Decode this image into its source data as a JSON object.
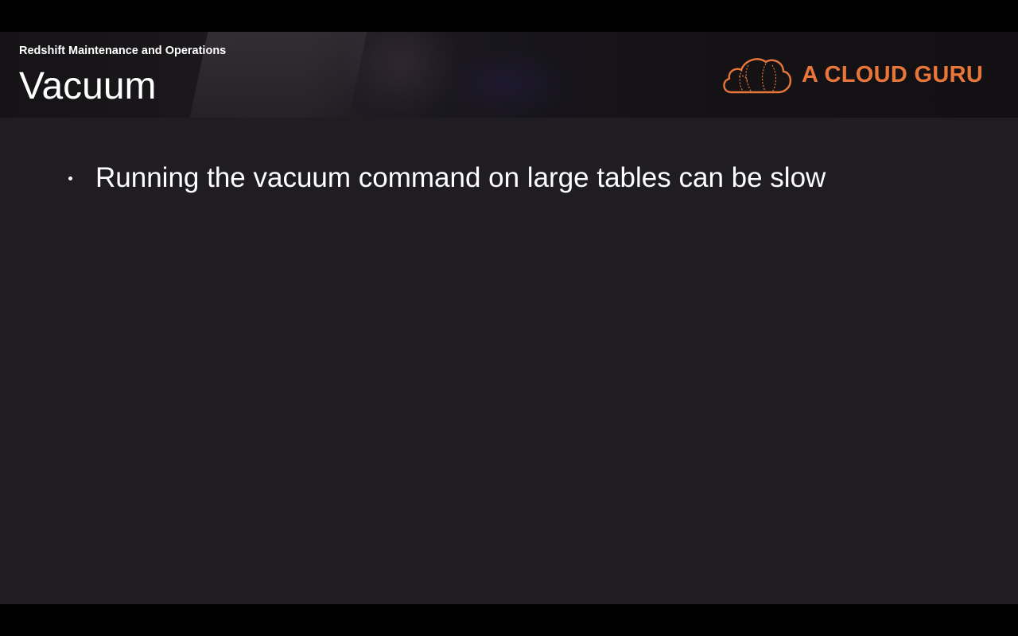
{
  "slide": {
    "subtitle": "Redshift Maintenance and Operations",
    "title": "Vacuum",
    "logo": {
      "text": "A CLOUD GURU",
      "icon": "cloud-icon",
      "color": "#e8763a"
    },
    "bullets": [
      "Running the vacuum command on large tables can be slow"
    ]
  },
  "colors": {
    "background": "#1f1d21",
    "letterbox": "#000000",
    "text": "#ffffff",
    "accent": "#e8763a"
  }
}
